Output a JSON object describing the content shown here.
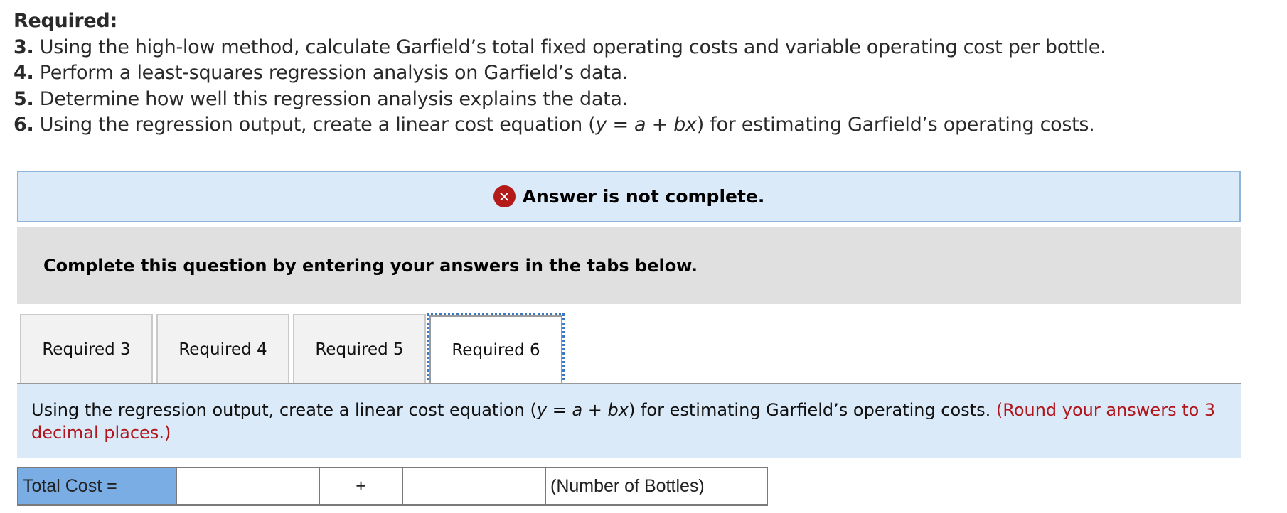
{
  "required": {
    "heading": "Required:",
    "items": [
      {
        "num": "3.",
        "text": "Using the high-low method, calculate Garfield’s total fixed operating costs and variable operating cost per bottle."
      },
      {
        "num": "4.",
        "text": "Perform a least-squares regression analysis on Garfield’s data."
      },
      {
        "num": "5.",
        "text": "Determine how well this regression analysis explains the data."
      },
      {
        "num": "6.",
        "text_before": "Using the regression output, create a linear cost equation (",
        "eq_y": "y",
        "eq_mid": " = ",
        "eq_a": "a",
        "eq_plus": " + ",
        "eq_bx": "bx",
        "text_after": ") for estimating Garfield’s operating costs."
      }
    ]
  },
  "alert": {
    "icon": "error-x-icon",
    "icon_glyph": "✕",
    "message": "Answer is not complete.",
    "icon_color": "#b31b1b"
  },
  "instruction": "Complete this question by entering your answers in the tabs below.",
  "tabs": [
    {
      "label": "Required 3",
      "active": false
    },
    {
      "label": "Required 4",
      "active": false
    },
    {
      "label": "Required 5",
      "active": false
    },
    {
      "label": "Required 6",
      "active": true
    }
  ],
  "tab_content": {
    "text_before": "Using the regression output, create a linear cost equation (",
    "eq_y": "y",
    "eq_equals": " = ",
    "eq_a": "a",
    "eq_plus": " + ",
    "eq_bx": "bx",
    "text_after": ") for estimating Garfield’s operating costs. ",
    "hint": "(Round your answers to 3 decimal places.)"
  },
  "equation": {
    "label": "Total Cost =",
    "fixed_cost_value": "",
    "operator": "+",
    "variable_cost_value": "",
    "suffix": "(Number of Bottles)"
  },
  "colors": {
    "alert_bg": "#dbeaf8",
    "alert_border": "#8fb4dc",
    "instruction_bg": "#e0e0e0",
    "label_cell_bg": "#79ade3",
    "hint_red": "#b0161c",
    "focus_outline": "#3a78c3"
  }
}
